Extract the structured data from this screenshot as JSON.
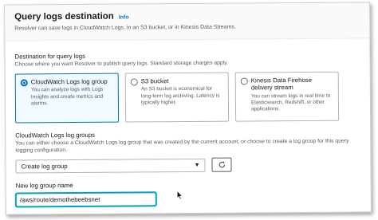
{
  "header": {
    "title": "Query logs destination",
    "info_link": "Info",
    "description": "Resolver can save logs in CloudWatch Logs, in an S3 bucket, or in Kinesis Data Streams."
  },
  "destination": {
    "label": "Destination for query logs",
    "hint": "Choose where you want Resolver to publish query logs. Standard storage charges apply.",
    "options": [
      {
        "title": "CloudWatch Logs log group",
        "description": "You can analyze logs with Logs Insights and create metrics and alarms.",
        "selected": true
      },
      {
        "title": "S3 bucket",
        "description": "An S3 bucket is economical for long-term log archiving. Latency is typically higher.",
        "selected": false
      },
      {
        "title": "Kinesis Data Firehose delivery stream",
        "description": "You can stream logs in real time to Elasticsearch, Redshift, or other applications.",
        "selected": false
      }
    ]
  },
  "log_groups": {
    "label": "CloudWatch Logs log groups",
    "hint": "You can either choose a CloudWatch Logs log group that was created by the current account, or choose to create a log group for this query logging configuration.",
    "selected_value": "Create log group",
    "refresh_icon": "refresh-icon"
  },
  "new_group": {
    "label": "New log group name",
    "value": "/aws/route/demothebeebsnet"
  },
  "colors": {
    "accent": "#0073bb",
    "focus": "#00a1c9"
  }
}
